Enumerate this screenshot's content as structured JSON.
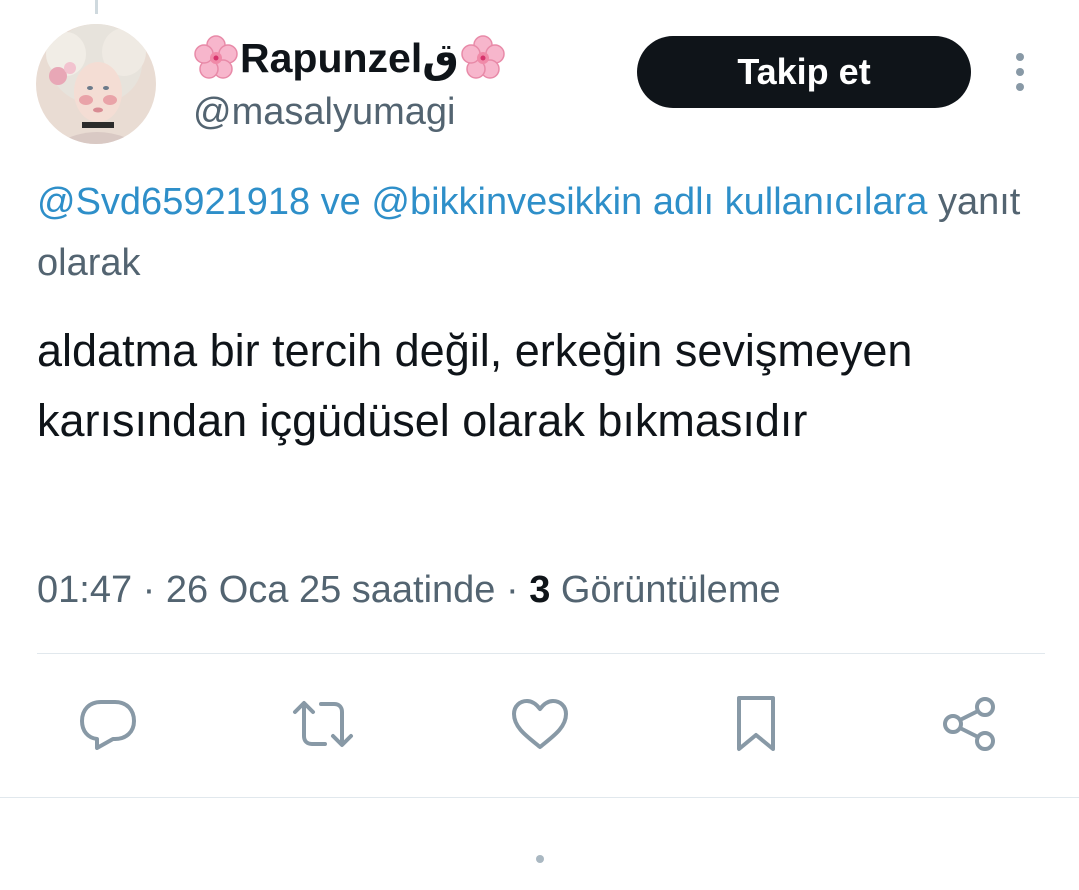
{
  "author": {
    "display_name": "Rapunzelق",
    "handle": "@masalyumagi"
  },
  "follow_button": {
    "label": "Takip et"
  },
  "reply_context": {
    "mention_1": "@Svd65921918",
    "joiner": " ve ",
    "mention_2": "@bikkinvesikkin adlı kullanıcılara",
    "suffix": " yanıt olarak"
  },
  "tweet": {
    "text": "aldatma bir tercih değil, erkeğin sevişmeyen karısından içgüdüsel olarak bıkmasıdır"
  },
  "meta": {
    "time": "01:47",
    "separator": " · ",
    "date": "26 Oca 25 saatinde",
    "views_count": "3",
    "views_label": " Görüntüleme"
  },
  "actions": [
    {
      "icon": "reply-icon"
    },
    {
      "icon": "retweet-icon"
    },
    {
      "icon": "like-icon"
    },
    {
      "icon": "bookmark-icon"
    },
    {
      "icon": "share-icon"
    }
  ],
  "colors": {
    "link": "#2e8fc9",
    "secondary_text": "#536471",
    "primary_text": "#0f1419",
    "button_bg": "#0f1419",
    "icon": "#8899a6"
  }
}
